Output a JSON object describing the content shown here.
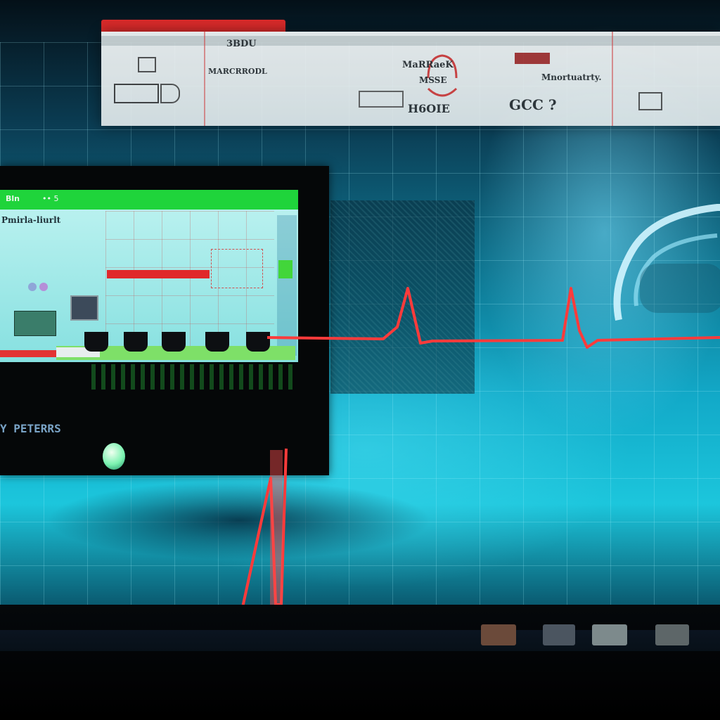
{
  "banner": {
    "cells": [
      {
        "lines": [
          "3BDU"
        ]
      },
      {
        "lines": [
          "MARCRRODL"
        ]
      },
      {
        "lines": [
          "MaRRaeK",
          "MSSE"
        ]
      },
      {
        "lines": [
          "H6OIE"
        ]
      },
      {
        "lines": [
          "Mnortuatrty.",
          "GCC ?"
        ]
      }
    ]
  },
  "monitor": {
    "screen_title": "Pmirla-liurlt",
    "label": "Y PETERRS",
    "top_strip": "Bln",
    "top_strip2": "•• 5"
  },
  "colors": {
    "accent_red": "#e0282a",
    "screen_green": "#1fd43b",
    "background_cyan": "#1cc6dc"
  },
  "icons": [
    "ecg-trace-icon",
    "led-indicator-icon",
    "camera-icon",
    "car-outline-icon"
  ]
}
